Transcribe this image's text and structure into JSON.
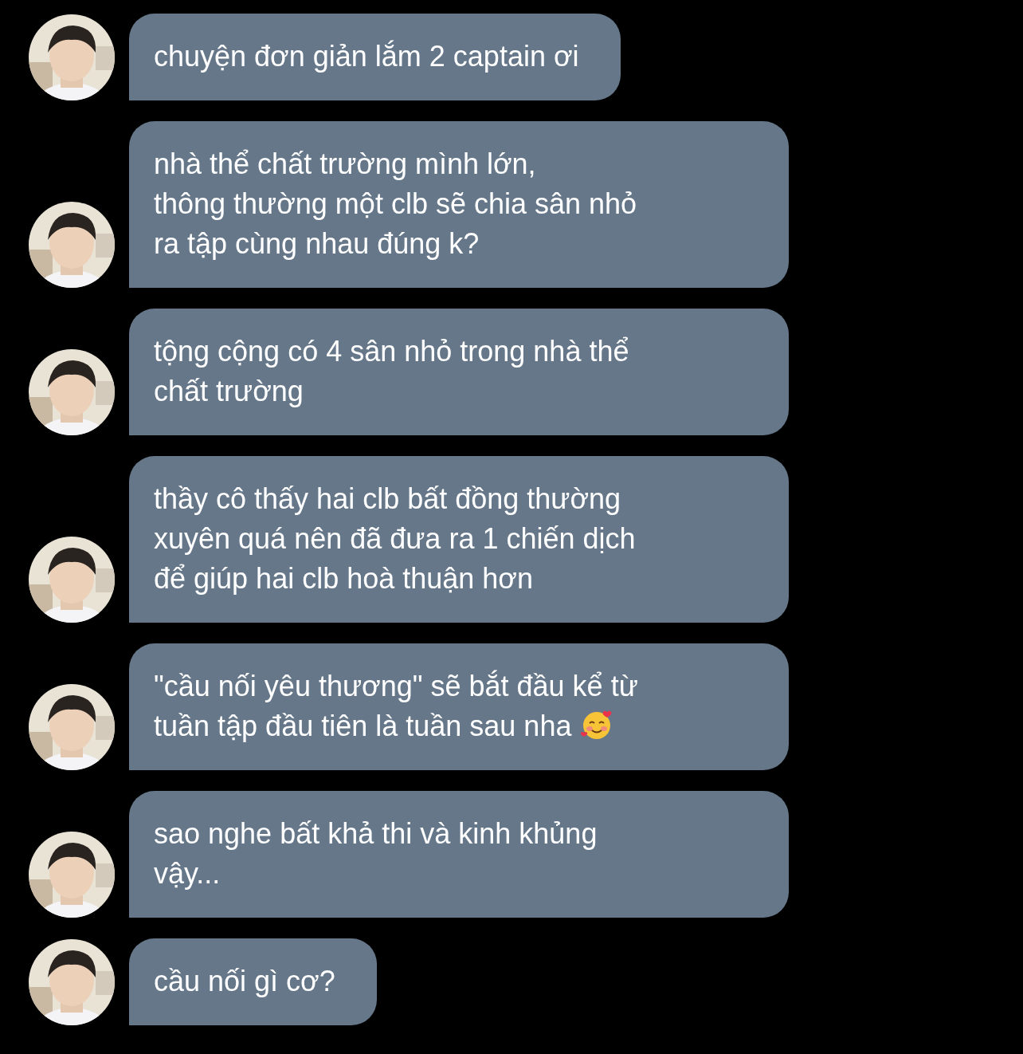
{
  "messages": [
    {
      "text": "chuyện đơn giản lắm 2 captain ơi"
    },
    {
      "text": "nhà thể chất trường mình lớn,\nthông thường một clb sẽ chia sân nhỏ\nra tập cùng nhau đúng k?"
    },
    {
      "text": "tộng cộng có 4 sân nhỏ trong nhà thể\nchất trường"
    },
    {
      "text": "thầy cô thấy hai clb bất đồng thường\nxuyên quá nên đã đưa ra 1 chiến dịch\nđể giúp hai clb hoà thuận hơn"
    },
    {
      "text": "\"cầu nối yêu thương\" sẽ bắt đầu kể từ\ntuần tập đầu tiên là tuần sau nha",
      "has_emoji": true
    },
    {
      "text": "sao nghe bất khả thi và kinh khủng\nvậy..."
    },
    {
      "text": "cầu nối gì cơ?"
    }
  ]
}
